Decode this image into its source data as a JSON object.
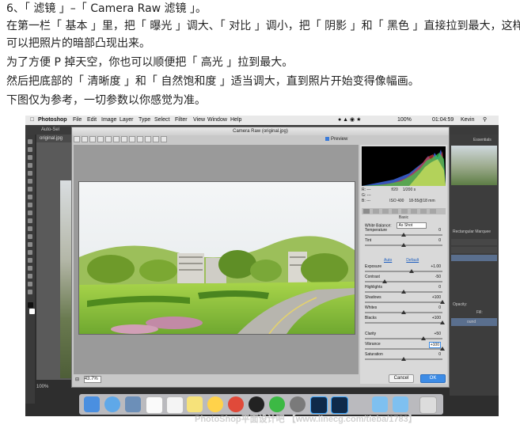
{
  "article": {
    "line1": "6、「 滤镜 」–「 Camera Raw 滤镜 」。",
    "line2": "在第一栏「 基本 」里，把「 曝光 」调大、「 对比 」调小，把「 阴影 」和「 黑色 」直接拉到最大，这样",
    "line3": "可以把照片的暗部凸现出来。",
    "line4": "为了方便 P 掉天空，你也可以顺便把「 高光 」拉到最大。",
    "line5": "然后把底部的「 清晰度 」和「 自然饱和度 」适当调大，直到照片开始变得像幅画。",
    "line6": "下图仅为参考，一切参数以你感觉为准。"
  },
  "mac_menubar": {
    "app": "Photoshop",
    "menus": [
      "File",
      "Edit",
      "Image",
      "Layer",
      "Type",
      "Select",
      "Filter",
      "View",
      "Window",
      "Help"
    ],
    "battery": "100%",
    "clock": "01:04:59",
    "user": "Kevin"
  },
  "ps": {
    "options_label": "Auto-Sel",
    "doc_tab": "original.jpg",
    "workspace": "Essentials",
    "status_zoom": "100%",
    "panel_labels": [
      "Rectangular Marquee",
      "Opacity:",
      "Fill:",
      "ound"
    ]
  },
  "camera_raw": {
    "title": "Camera Raw (original.jpg)",
    "preview_label": "Preview",
    "zoom": "43.7%",
    "camera_info": {
      "r": "R: ---",
      "g": "G: ---",
      "b": "B: ---",
      "aperture": "f/20",
      "shutter": "1/200 s",
      "iso": "ISO 400",
      "lens": "18-55@18 mm"
    },
    "panel_tab": "Basic",
    "white_balance_label": "White Balance:",
    "white_balance_value": "As Shot",
    "auto_label": "Auto",
    "default_label": "Default",
    "sliders": [
      {
        "name": "Temperature",
        "value": "0",
        "pos": 0.5
      },
      {
        "name": "Tint",
        "value": "0",
        "pos": 0.5
      },
      {
        "name": "Exposure",
        "value": "+1.00",
        "pos": 0.6
      },
      {
        "name": "Contrast",
        "value": "-50",
        "pos": 0.25
      },
      {
        "name": "Highlights",
        "value": "0",
        "pos": 0.5
      },
      {
        "name": "Shadows",
        "value": "+100",
        "pos": 1.0
      },
      {
        "name": "Whites",
        "value": "0",
        "pos": 0.5
      },
      {
        "name": "Blacks",
        "value": "+100",
        "pos": 1.0
      },
      {
        "name": "Clarity",
        "value": "+50",
        "pos": 0.75
      },
      {
        "name": "Vibrance",
        "value": "+100",
        "pos": 1.0
      },
      {
        "name": "Saturation",
        "value": "0",
        "pos": 0.5
      }
    ],
    "cancel_label": "Cancel",
    "ok_label": "OK"
  },
  "watermark": "PhotoShop平面设计吧 【www.linecg.com/tieba/1783】"
}
